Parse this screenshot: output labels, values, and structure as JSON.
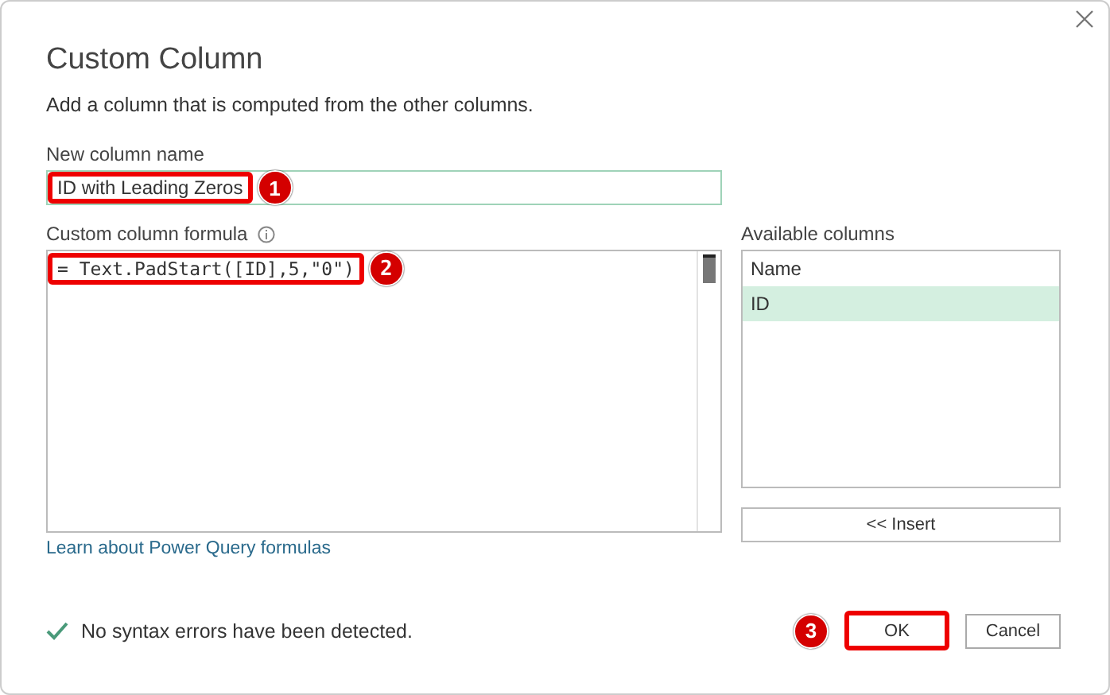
{
  "dialog": {
    "title": "Custom Column",
    "subtitle": "Add a column that is computed from the other columns."
  },
  "new_column_name": {
    "label": "New column name",
    "value": "ID with Leading Zeros"
  },
  "formula": {
    "label": "Custom column formula",
    "value": "= Text.PadStart([ID],5,\"0\")"
  },
  "available_columns": {
    "label": "Available columns",
    "header": "Name",
    "items": [
      {
        "label": "ID",
        "selected": true
      }
    ],
    "insert_button": "<< Insert"
  },
  "link": "Learn about Power Query formulas",
  "status": {
    "ok": true,
    "text": "No syntax errors have been detected."
  },
  "buttons": [
    "OK",
    "Cancel"
  ],
  "callouts": [
    "1",
    "2",
    "3"
  ]
}
